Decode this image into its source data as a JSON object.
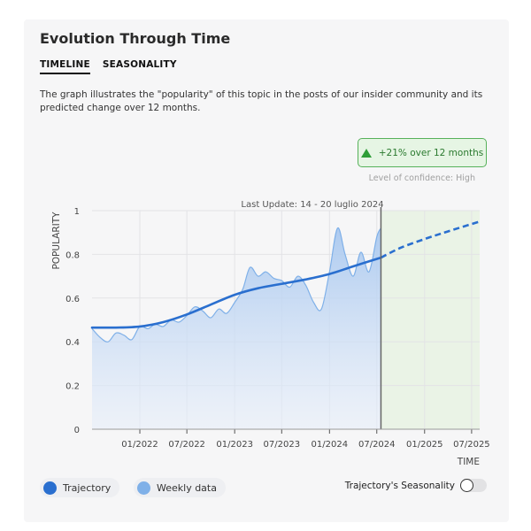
{
  "title": "Evolution Through Time",
  "tabs": [
    {
      "label": "TIMELINE",
      "active": true
    },
    {
      "label": "SEASONALITY",
      "active": false
    }
  ],
  "description": "The graph illustrates the \"popularity\" of this topic in the posts of our insider community and its predicted change over 12 months.",
  "badge": {
    "text": "+21% over 12 months",
    "icon": "arrow-up-triangle-icon",
    "color": "#2e9e37"
  },
  "confidence_text": "Level of confidence: High",
  "legend": {
    "trajectory": "Trajectory",
    "weekly": "Weekly data",
    "seasonality_label": "Trajectory's Seasonality",
    "seasonality_on": false
  },
  "colors": {
    "trajectory": "#2a6fcf",
    "weekly_fill": "#b9d3f2",
    "weekly_line": "#7fb0e8",
    "forecast_bg": "#eaf3e6"
  },
  "chart_data": {
    "type": "line",
    "annotation": "Last Update: 14 - 20 luglio 2024",
    "ylabel": "POPULARITY",
    "xlabel": "TIME",
    "ylim": [
      0,
      1
    ],
    "yticks": [
      "0",
      "0.2",
      "0.4",
      "0.6",
      "0.8",
      "1"
    ],
    "xlim": [
      "2021-07-01",
      "2025-08-01"
    ],
    "xticks": [
      {
        "date": "2022-01-01",
        "label": "01/2022"
      },
      {
        "date": "2022-07-01",
        "label": "07/2022"
      },
      {
        "date": "2023-01-01",
        "label": "01/2023"
      },
      {
        "date": "2023-07-01",
        "label": "07/2023"
      },
      {
        "date": "2024-01-01",
        "label": "01/2024"
      },
      {
        "date": "2024-07-01",
        "label": "07/2024"
      },
      {
        "date": "2025-01-01",
        "label": "01/2025"
      },
      {
        "date": "2025-07-01",
        "label": "07/2025"
      }
    ],
    "last_update_date": "2024-07-17",
    "grid": true,
    "series": [
      {
        "name": "Weekly data",
        "style": "area",
        "x": [
          "2021-07-01",
          "2021-08-01",
          "2021-09-01",
          "2021-10-01",
          "2021-11-01",
          "2021-12-01",
          "2022-01-01",
          "2022-02-01",
          "2022-03-01",
          "2022-04-01",
          "2022-05-01",
          "2022-06-01",
          "2022-07-01",
          "2022-08-01",
          "2022-09-01",
          "2022-10-01",
          "2022-11-01",
          "2022-12-01",
          "2023-01-01",
          "2023-02-01",
          "2023-03-01",
          "2023-04-01",
          "2023-05-01",
          "2023-06-01",
          "2023-07-01",
          "2023-08-01",
          "2023-09-01",
          "2023-10-01",
          "2023-11-01",
          "2023-12-01",
          "2024-01-01",
          "2024-02-01",
          "2024-03-01",
          "2024-04-01",
          "2024-05-01",
          "2024-06-01",
          "2024-07-01",
          "2024-07-17"
        ],
        "values": [
          0.46,
          0.42,
          0.4,
          0.44,
          0.43,
          0.41,
          0.47,
          0.46,
          0.48,
          0.47,
          0.5,
          0.49,
          0.52,
          0.56,
          0.54,
          0.51,
          0.55,
          0.53,
          0.58,
          0.64,
          0.74,
          0.7,
          0.72,
          0.69,
          0.68,
          0.65,
          0.7,
          0.66,
          0.58,
          0.55,
          0.72,
          0.92,
          0.8,
          0.7,
          0.81,
          0.72,
          0.88,
          0.92
        ]
      },
      {
        "name": "Trajectory",
        "style": "line",
        "x": [
          "2021-07-01",
          "2021-10-01",
          "2022-01-01",
          "2022-04-01",
          "2022-07-01",
          "2022-10-01",
          "2023-01-01",
          "2023-04-01",
          "2023-07-01",
          "2023-10-01",
          "2024-01-01",
          "2024-04-01",
          "2024-07-17"
        ],
        "values": [
          0.465,
          0.465,
          0.47,
          0.49,
          0.525,
          0.57,
          0.615,
          0.645,
          0.665,
          0.685,
          0.71,
          0.745,
          0.785
        ]
      },
      {
        "name": "Trajectory",
        "style": "dashed",
        "x": [
          "2024-07-17",
          "2024-10-01",
          "2025-01-01",
          "2025-04-01",
          "2025-08-01"
        ],
        "values": [
          0.785,
          0.83,
          0.87,
          0.905,
          0.95
        ]
      }
    ]
  }
}
